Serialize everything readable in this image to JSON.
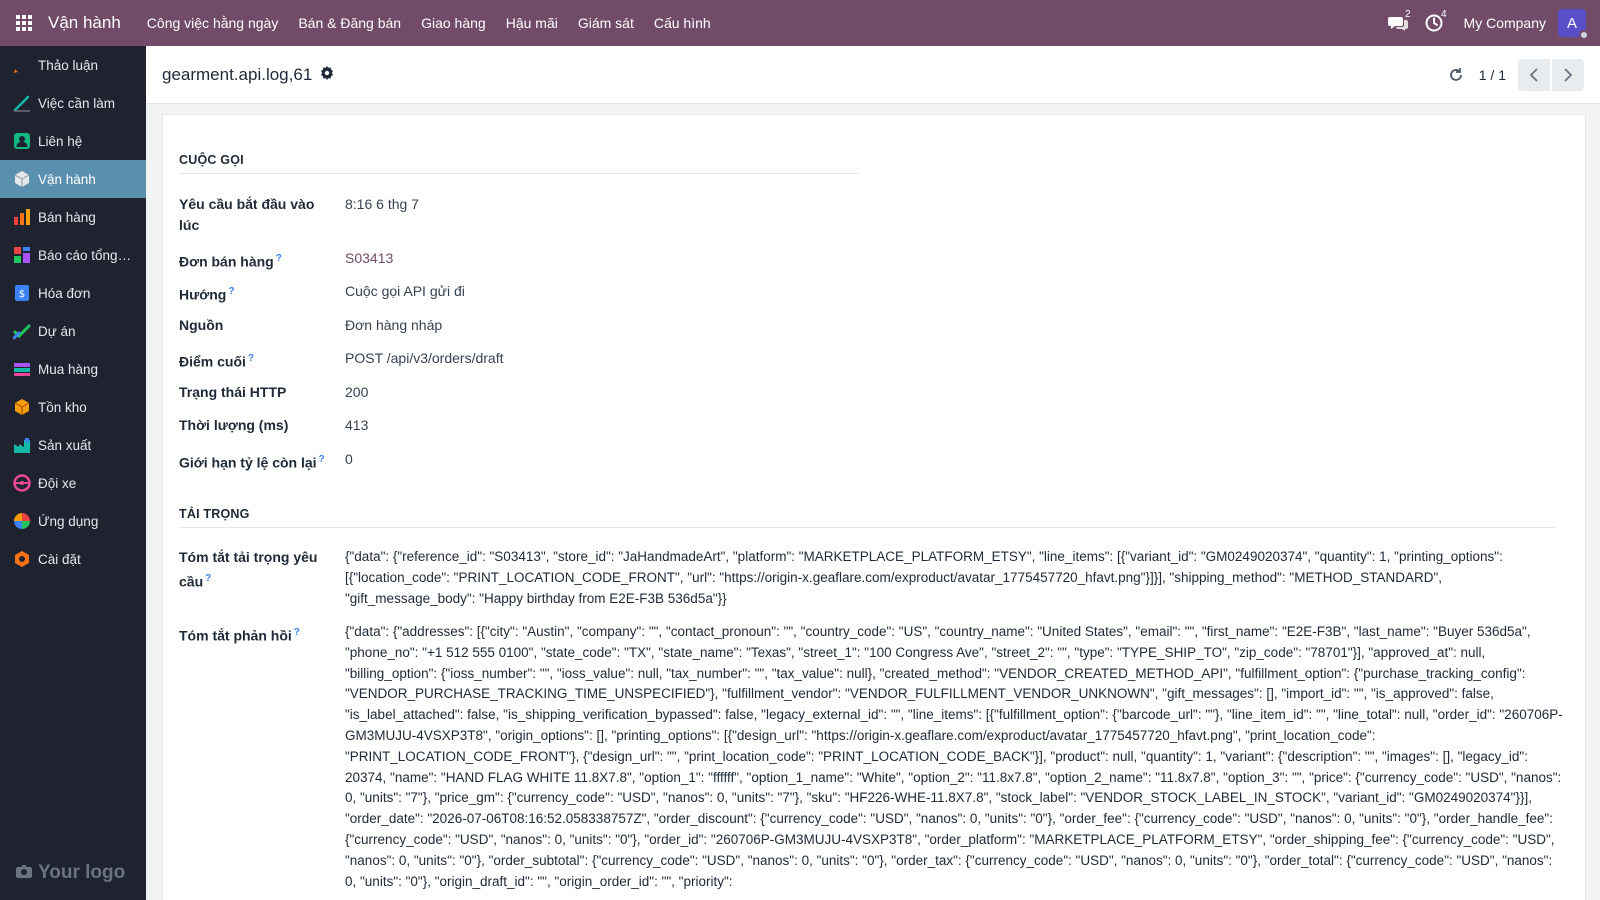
{
  "navbar": {
    "brand": "Vận hành",
    "menu": [
      "Công việc hằng ngày",
      "Bán & Đăng bán",
      "Giao hàng",
      "Hậu mãi",
      "Giám sát",
      "Cấu hình"
    ],
    "messages_count": "2",
    "activities_count": "4",
    "company": "My Company",
    "avatar_letter": "A"
  },
  "sidebar": {
    "items": [
      {
        "label": "Thảo luận",
        "icon": "discuss-icon",
        "color": "#f97316"
      },
      {
        "label": "Việc cần làm",
        "icon": "todo-icon",
        "color": "#14b8a6"
      },
      {
        "label": "Liên hệ",
        "icon": "contacts-icon",
        "color": "#10b981"
      },
      {
        "label": "Vận hành",
        "icon": "operations-icon",
        "color": "#9ca3af"
      },
      {
        "label": "Bán hàng",
        "icon": "sales-icon",
        "color": "#f97316"
      },
      {
        "label": "Báo cáo tổng ...",
        "icon": "dashboard-icon",
        "color": "#ef4444"
      },
      {
        "label": "Hóa đơn",
        "icon": "invoice-icon",
        "color": "#3b82f6"
      },
      {
        "label": "Dự án",
        "icon": "project-icon",
        "color": "#22c55e"
      },
      {
        "label": "Mua hàng",
        "icon": "purchase-icon",
        "color": "#a855f7"
      },
      {
        "label": "Tồn kho",
        "icon": "inventory-icon",
        "color": "#f59e0b"
      },
      {
        "label": "Sản xuất",
        "icon": "manufacturing-icon",
        "color": "#14b8a6"
      },
      {
        "label": "Đội xe",
        "icon": "fleet-icon",
        "color": "#ec4899"
      },
      {
        "label": "Ứng dụng",
        "icon": "apps-icon",
        "color": "#3b82f6"
      },
      {
        "label": "Cài đặt",
        "icon": "settings-icon",
        "color": "#f97316"
      }
    ],
    "active_index": 3,
    "footer_logo": "Your logo"
  },
  "control_panel": {
    "record_title": "gearment.api.log,61",
    "pager": "1 / 1"
  },
  "form": {
    "section_call": "CUỘC GỌI",
    "fields": [
      {
        "label": "Yêu cầu bắt đầu vào lúc",
        "value": "8:16 6 thg 7",
        "help": false,
        "link": false
      },
      {
        "label": "Đơn bán hàng",
        "value": "S03413",
        "help": true,
        "link": true
      },
      {
        "label": "Hướng",
        "value": "Cuộc gọi API gửi đi",
        "help": true,
        "link": false
      },
      {
        "label": "Nguồn",
        "value": "Đơn hàng nháp",
        "help": false,
        "link": false
      },
      {
        "label": "Điểm cuối",
        "value": "POST /api/v3/orders/draft",
        "help": true,
        "link": false
      },
      {
        "label": "Trạng thái HTTP",
        "value": "200",
        "help": false,
        "link": false
      },
      {
        "label": "Thời lượng (ms)",
        "value": "413",
        "help": false,
        "link": false
      },
      {
        "label": "Giới hạn tỷ lệ còn lại",
        "value": "0",
        "help": true,
        "link": false
      }
    ],
    "section_payload": "TẢI TRỌNG",
    "request_label": "Tóm tắt tải trọng yêu cầu",
    "request_value": "{\"data\": {\"reference_id\": \"S03413\", \"store_id\": \"JaHandmadeArt\", \"platform\": \"MARKETPLACE_PLATFORM_ETSY\", \"line_items\": [{\"variant_id\": \"GM0249020374\", \"quantity\": 1, \"printing_options\": [{\"location_code\": \"PRINT_LOCATION_CODE_FRONT\", \"url\": \"https://origin-x.geaflare.com/exproduct/avatar_1775457720_hfavt.png\"}]}], \"shipping_method\": \"METHOD_STANDARD\", \"gift_message_body\": \"Happy birthday from E2E-F3B 536d5a\"}}",
    "response_label": "Tóm tắt phản hồi",
    "response_value": "{\"data\": {\"addresses\": [{\"city\": \"Austin\", \"company\": \"\", \"contact_pronoun\": \"\", \"country_code\": \"US\", \"country_name\": \"United States\", \"email\": \"\", \"first_name\": \"E2E-F3B\", \"last_name\": \"Buyer 536d5a\", \"phone_no\": \"+1 512 555 0100\", \"state_code\": \"TX\", \"state_name\": \"Texas\", \"street_1\": \"100 Congress Ave\", \"street_2\": \"\", \"type\": \"TYPE_SHIP_TO\", \"zip_code\": \"78701\"}], \"approved_at\": null, \"billing_option\": {\"ioss_number\": \"\", \"ioss_value\": null, \"tax_number\": \"\", \"tax_value\": null}, \"created_method\": \"VENDOR_CREATED_METHOD_API\", \"fulfillment_option\": {\"purchase_tracking_config\": \"VENDOR_PURCHASE_TRACKING_TIME_UNSPECIFIED\"}, \"fulfillment_vendor\": \"VENDOR_FULFILLMENT_VENDOR_UNKNOWN\", \"gift_messages\": [], \"import_id\": \"\", \"is_approved\": false, \"is_label_attached\": false, \"is_shipping_verification_bypassed\": false, \"legacy_external_id\": \"\", \"line_items\": [{\"fulfillment_option\": {\"barcode_url\": \"\"}, \"line_item_id\": \"\", \"line_total\": null, \"order_id\": \"260706P-GM3MUJU-4VSXP3T8\", \"origin_options\": [], \"printing_options\": [{\"design_url\": \"https://origin-x.geaflare.com/exproduct/avatar_1775457720_hfavt.png\", \"print_location_code\": \"PRINT_LOCATION_CODE_FRONT\"}, {\"design_url\": \"\", \"print_location_code\": \"PRINT_LOCATION_CODE_BACK\"}], \"product\": null, \"quantity\": 1, \"variant\": {\"description\": \"\", \"images\": [], \"legacy_id\": 20374, \"name\": \"HAND FLAG WHITE 11.8X7.8\", \"option_1\": \"ffffff\", \"option_1_name\": \"White\", \"option_2\": \"11.8x7.8\", \"option_2_name\": \"11.8x7.8\", \"option_3\": \"\", \"price\": {\"currency_code\": \"USD\", \"nanos\": 0, \"units\": \"7\"}, \"price_gm\": {\"currency_code\": \"USD\", \"nanos\": 0, \"units\": \"7\"}, \"sku\": \"HF226-WHE-11.8X7.8\", \"stock_label\": \"VENDOR_STOCK_LABEL_IN_STOCK\", \"variant_id\": \"GM0249020374\"}}], \"order_date\": \"2026-07-06T08:16:52.058338757Z\", \"order_discount\": {\"currency_code\": \"USD\", \"nanos\": 0, \"units\": \"0\"}, \"order_fee\": {\"currency_code\": \"USD\", \"nanos\": 0, \"units\": \"0\"}, \"order_handle_fee\": {\"currency_code\": \"USD\", \"nanos\": 0, \"units\": \"0\"}, \"order_id\": \"260706P-GM3MUJU-4VSXP3T8\", \"order_platform\": \"MARKETPLACE_PLATFORM_ETSY\", \"order_shipping_fee\": {\"currency_code\": \"USD\", \"nanos\": 0, \"units\": \"0\"}, \"order_subtotal\": {\"currency_code\": \"USD\", \"nanos\": 0, \"units\": \"0\"}, \"order_tax\": {\"currency_code\": \"USD\", \"nanos\": 0, \"units\": \"0\"}, \"order_total\": {\"currency_code\": \"USD\", \"nanos\": 0, \"units\": \"0\"}, \"origin_draft_id\": \"\", \"origin_order_id\": \"\", \"priority\":",
    "help_mark": "?"
  },
  "colors": {
    "navbar": "#714B67",
    "sidebar": "#1f2330",
    "active_item": "#5a8fae",
    "link": "#714B67",
    "help": "#3b82f6"
  }
}
